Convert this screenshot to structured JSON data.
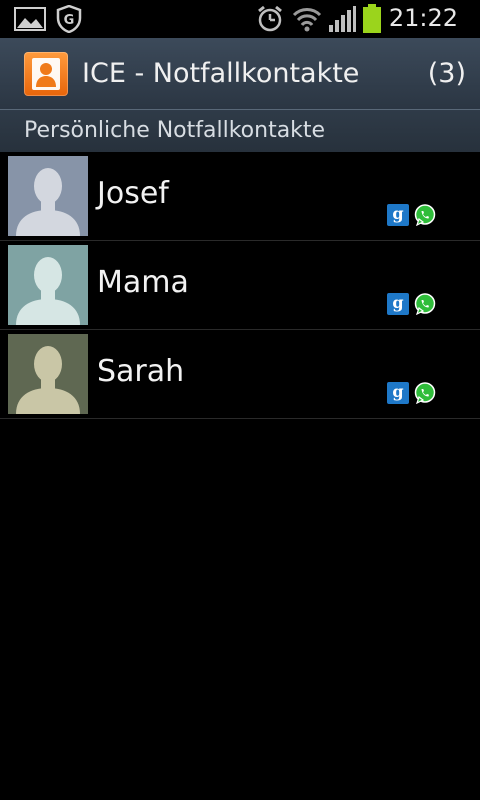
{
  "statusbar": {
    "time": "21:22",
    "icons": [
      "gallery-icon",
      "shield-icon",
      "alarm-icon",
      "wifi-icon",
      "signal-icon",
      "battery-icon"
    ]
  },
  "actionbar": {
    "title": "ICE - Notfallkontakte",
    "count": "(3)",
    "icon": "contact-icon"
  },
  "section": {
    "title": "Persönliche Notfallkontakte"
  },
  "contacts": [
    {
      "name": "Josef",
      "avatar_color": "#8794a8",
      "badges": [
        "g",
        "whatsapp"
      ]
    },
    {
      "name": "Mama",
      "avatar_color": "#7fa3a3",
      "badges": [
        "g",
        "whatsapp"
      ]
    },
    {
      "name": "Sarah",
      "avatar_color": "#5f6852",
      "badges": [
        "g",
        "whatsapp"
      ]
    }
  ],
  "colors": {
    "accent": "#f07a1a",
    "google": "#1e78c8",
    "whatsapp": "#2fbd3a",
    "battery": "#9bd41c"
  }
}
